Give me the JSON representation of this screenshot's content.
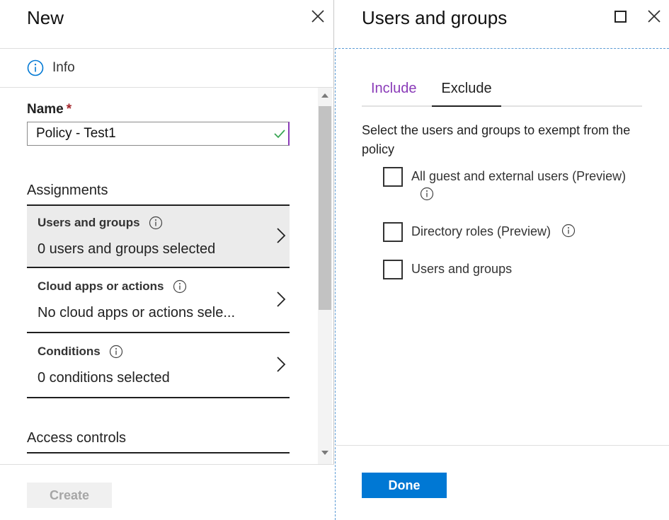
{
  "left_blade": {
    "title": "New",
    "info_label": "Info",
    "name_label": "Name",
    "required_mark": "*",
    "name_value": "Policy - Test1",
    "assignments_label": "Assignments",
    "items": [
      {
        "title": "Users and groups",
        "subtitle": "0 users and groups selected",
        "selected": true
      },
      {
        "title": "Cloud apps or actions",
        "subtitle": "No cloud apps or actions sele...",
        "selected": false
      },
      {
        "title": "Conditions",
        "subtitle": "0 conditions selected",
        "selected": false
      }
    ],
    "access_controls_label": "Access controls",
    "create_label": "Create"
  },
  "right_blade": {
    "title": "Users and groups",
    "tabs": [
      {
        "label": "Include",
        "active": false
      },
      {
        "label": "Exclude",
        "active": true
      }
    ],
    "description": "Select the users and groups to exempt from the policy",
    "options": [
      {
        "label": "All guest and external users (Preview)",
        "checked": false,
        "has_info": true
      },
      {
        "label": "Directory roles (Preview)",
        "checked": false,
        "has_info": true
      },
      {
        "label": "Users and groups",
        "checked": false,
        "has_info": false
      }
    ],
    "done_label": "Done"
  },
  "colors": {
    "accent": "#0078d4",
    "tab_inactive": "#8a3bb8",
    "required": "#a4262c",
    "valid_check": "#3aa655"
  },
  "icons": [
    "close-icon",
    "info-icon",
    "check-icon",
    "chevron-right-icon",
    "maximize-icon"
  ]
}
